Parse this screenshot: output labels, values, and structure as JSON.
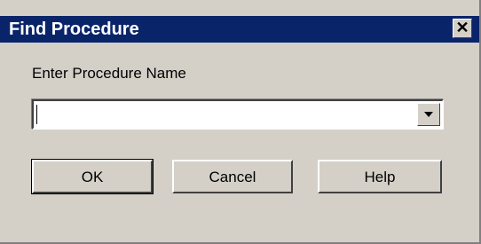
{
  "window": {
    "title": "Find Procedure",
    "close_glyph": "✕"
  },
  "prompt": {
    "label": "Enter Procedure Name"
  },
  "procedure_combo": {
    "value": "",
    "arrow_icon": "chevron-down-icon"
  },
  "buttons": {
    "ok_label": "OK",
    "cancel_label": "Cancel",
    "help_label": "Help"
  },
  "colors": {
    "titlebar": "#0a246a",
    "face": "#d4d0c8"
  }
}
